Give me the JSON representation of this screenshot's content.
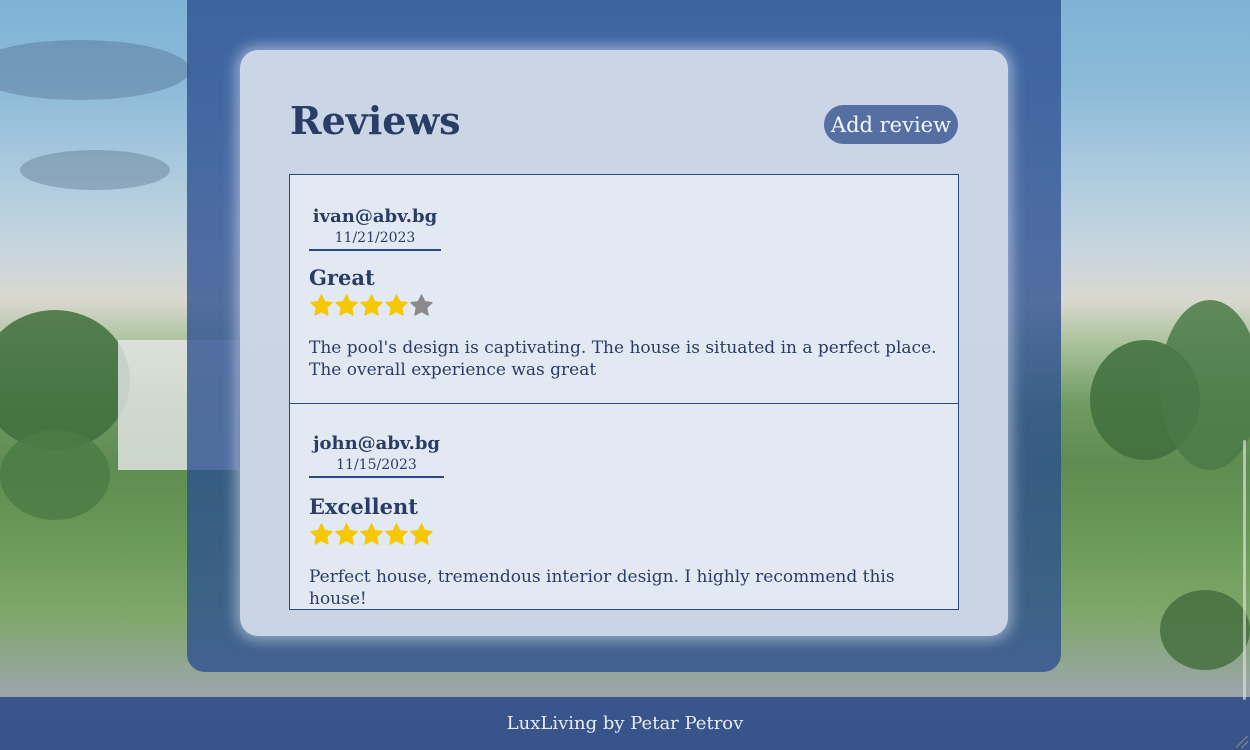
{
  "page": {
    "title": "Reviews",
    "add_review_label": "Add review"
  },
  "reviews": [
    {
      "author": "ivan@abv.bg",
      "date": "11/21/2023",
      "title": "Great",
      "rating": 4,
      "max_rating": 5,
      "text": "The pool's design is captivating. The house is situated in a perfect place. The overall experience was great"
    },
    {
      "author": "john@abv.bg",
      "date": "11/15/2023",
      "title": "Excellent",
      "rating": 5,
      "max_rating": 5,
      "text": "Perfect house, tremendous interior design. I highly recommend this house!"
    }
  ],
  "footer": {
    "text": "LuxLiving by Petar Petrov"
  },
  "colors": {
    "star_filled": "#f5c800",
    "star_empty": "#8a8a8a",
    "primary": "#2a3d66",
    "button_bg": "#556fa3",
    "panel": "#2c4e91"
  },
  "icons": {
    "star": "star-icon"
  }
}
